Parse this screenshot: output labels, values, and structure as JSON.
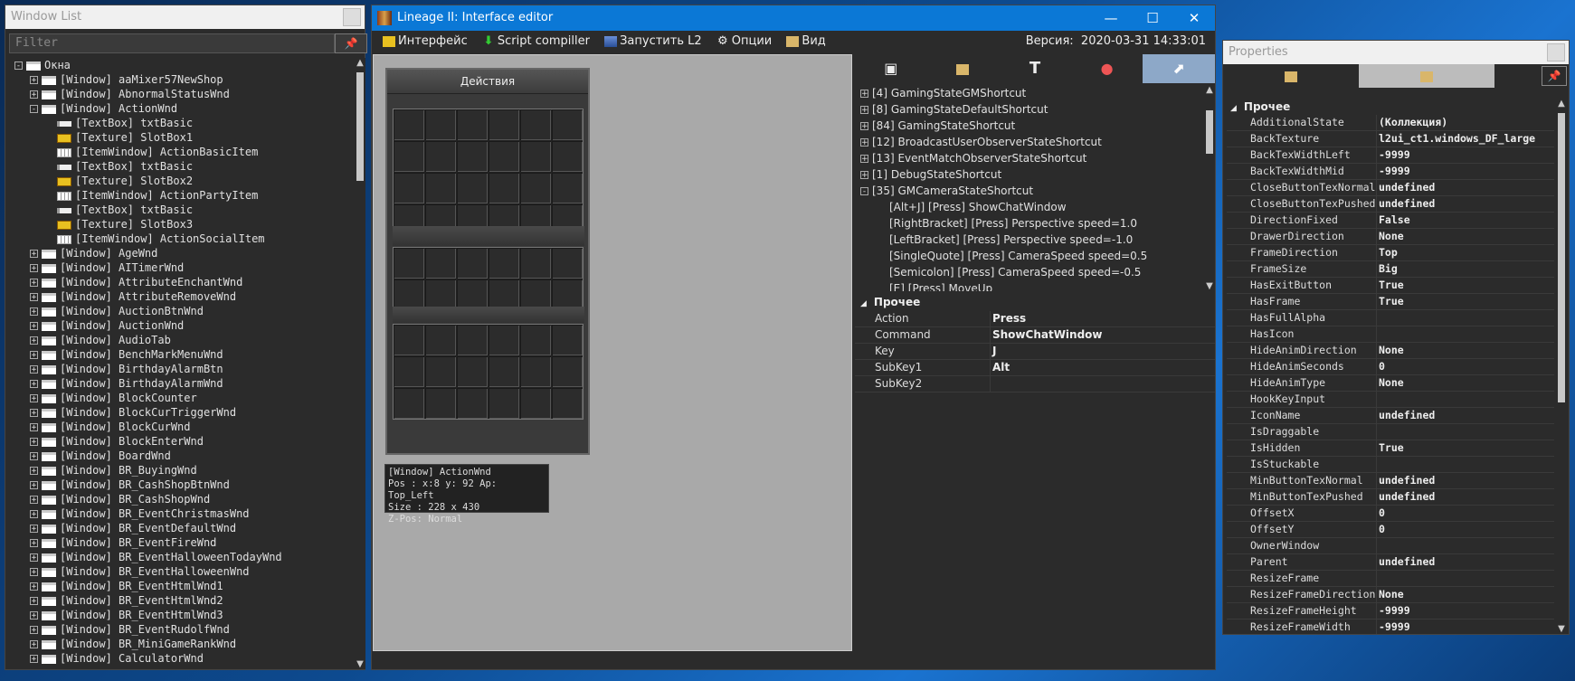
{
  "window_list": {
    "title": "Window List",
    "filter_placeholder": "Filter",
    "tree": [
      {
        "level": 0,
        "pm": "-",
        "icon": "win",
        "text": "Окна"
      },
      {
        "level": 1,
        "pm": "+",
        "icon": "win",
        "text": "[Window] aaMixer57NewShop"
      },
      {
        "level": 1,
        "pm": "+",
        "icon": "win",
        "text": "[Window] AbnormalStatusWnd"
      },
      {
        "level": 1,
        "pm": "-",
        "icon": "win",
        "text": "[Window] ActionWnd"
      },
      {
        "level": 2,
        "pm": "",
        "icon": "tb",
        "text": "[TextBox] txtBasic"
      },
      {
        "level": 2,
        "pm": "",
        "icon": "tx",
        "text": "[Texture] SlotBox1"
      },
      {
        "level": 2,
        "pm": "",
        "icon": "iw",
        "text": "[ItemWindow] ActionBasicItem"
      },
      {
        "level": 2,
        "pm": "",
        "icon": "tb",
        "text": "[TextBox] txtBasic"
      },
      {
        "level": 2,
        "pm": "",
        "icon": "tx",
        "text": "[Texture] SlotBox2"
      },
      {
        "level": 2,
        "pm": "",
        "icon": "iw",
        "text": "[ItemWindow] ActionPartyItem"
      },
      {
        "level": 2,
        "pm": "",
        "icon": "tb",
        "text": "[TextBox] txtBasic"
      },
      {
        "level": 2,
        "pm": "",
        "icon": "tx",
        "text": "[Texture] SlotBox3"
      },
      {
        "level": 2,
        "pm": "",
        "icon": "iw",
        "text": "[ItemWindow] ActionSocialItem"
      },
      {
        "level": 1,
        "pm": "+",
        "icon": "win",
        "text": "[Window] AgeWnd"
      },
      {
        "level": 1,
        "pm": "+",
        "icon": "win",
        "text": "[Window] AITimerWnd"
      },
      {
        "level": 1,
        "pm": "+",
        "icon": "win",
        "text": "[Window] AttributeEnchantWnd"
      },
      {
        "level": 1,
        "pm": "+",
        "icon": "win",
        "text": "[Window] AttributeRemoveWnd"
      },
      {
        "level": 1,
        "pm": "+",
        "icon": "win",
        "text": "[Window] AuctionBtnWnd"
      },
      {
        "level": 1,
        "pm": "+",
        "icon": "win",
        "text": "[Window] AuctionWnd"
      },
      {
        "level": 1,
        "pm": "+",
        "icon": "win",
        "text": "[Window] AudioTab"
      },
      {
        "level": 1,
        "pm": "+",
        "icon": "win",
        "text": "[Window] BenchMarkMenuWnd"
      },
      {
        "level": 1,
        "pm": "+",
        "icon": "win",
        "text": "[Window] BirthdayAlarmBtn"
      },
      {
        "level": 1,
        "pm": "+",
        "icon": "win",
        "text": "[Window] BirthdayAlarmWnd"
      },
      {
        "level": 1,
        "pm": "+",
        "icon": "win",
        "text": "[Window] BlockCounter"
      },
      {
        "level": 1,
        "pm": "+",
        "icon": "win",
        "text": "[Window] BlockCurTriggerWnd"
      },
      {
        "level": 1,
        "pm": "+",
        "icon": "win",
        "text": "[Window] BlockCurWnd"
      },
      {
        "level": 1,
        "pm": "+",
        "icon": "win",
        "text": "[Window] BlockEnterWnd"
      },
      {
        "level": 1,
        "pm": "+",
        "icon": "win",
        "text": "[Window] BoardWnd"
      },
      {
        "level": 1,
        "pm": "+",
        "icon": "win",
        "text": "[Window] BR_BuyingWnd"
      },
      {
        "level": 1,
        "pm": "+",
        "icon": "win",
        "text": "[Window] BR_CashShopBtnWnd"
      },
      {
        "level": 1,
        "pm": "+",
        "icon": "win",
        "text": "[Window] BR_CashShopWnd"
      },
      {
        "level": 1,
        "pm": "+",
        "icon": "win",
        "text": "[Window] BR_EventChristmasWnd"
      },
      {
        "level": 1,
        "pm": "+",
        "icon": "win",
        "text": "[Window] BR_EventDefaultWnd"
      },
      {
        "level": 1,
        "pm": "+",
        "icon": "win",
        "text": "[Window] BR_EventFireWnd"
      },
      {
        "level": 1,
        "pm": "+",
        "icon": "win",
        "text": "[Window] BR_EventHalloweenTodayWnd"
      },
      {
        "level": 1,
        "pm": "+",
        "icon": "win",
        "text": "[Window] BR_EventHalloweenWnd"
      },
      {
        "level": 1,
        "pm": "+",
        "icon": "win",
        "text": "[Window] BR_EventHtmlWnd1"
      },
      {
        "level": 1,
        "pm": "+",
        "icon": "win",
        "text": "[Window] BR_EventHtmlWnd2"
      },
      {
        "level": 1,
        "pm": "+",
        "icon": "win",
        "text": "[Window] BR_EventHtmlWnd3"
      },
      {
        "level": 1,
        "pm": "+",
        "icon": "win",
        "text": "[Window] BR_EventRudolfWnd"
      },
      {
        "level": 1,
        "pm": "+",
        "icon": "win",
        "text": "[Window] BR_MiniGameRankWnd"
      },
      {
        "level": 1,
        "pm": "+",
        "icon": "win",
        "text": "[Window] CalculatorWnd"
      }
    ]
  },
  "editor": {
    "title": "Lineage II: Interface editor",
    "menu": [
      "Интерфейс",
      "Script compiller",
      "Запустить L2",
      "Опции",
      "Вид"
    ],
    "version_label": "Версия:",
    "version_value": "2020-03-31 14:33:01",
    "game_window_title": "Действия",
    "info": {
      "line1": "[Window] ActionWnd",
      "line2": "Pos  : x:8 y: 92 Ap: Top_Left",
      "line3": "Size : 228 x 430",
      "line4": "Z-Pos: Normal"
    },
    "tab_icons": [
      "windows-icon",
      "texture-icon",
      "text-icon",
      "color-icon",
      "shortcut-icon"
    ],
    "shortcuts": [
      {
        "pm": "+",
        "text": "[4] GamingStateGMShortcut"
      },
      {
        "pm": "+",
        "text": "[8] GamingStateDefaultShortcut"
      },
      {
        "pm": "+",
        "text": "[84] GamingStateShortcut"
      },
      {
        "pm": "+",
        "text": "[12] BroadcastUserObserverStateShortcut"
      },
      {
        "pm": "+",
        "text": "[13] EventMatchObserverStateShortcut"
      },
      {
        "pm": "+",
        "text": "[1] DebugStateShortcut"
      },
      {
        "pm": "-",
        "text": "[35] GMCameraStateShortcut"
      }
    ],
    "shortcut_children": [
      "[Alt+J] [Press] ShowChatWindow",
      "[RightBracket] [Press] Perspective speed=1.0",
      "[LeftBracket] [Press] Perspective speed=-1.0",
      "[SingleQuote] [Press] CameraSpeed speed=0.5",
      "[Semicolon] [Press] CameraSpeed speed=-0.5",
      "[E] [Press] MoveUp"
    ],
    "section": "Прочее",
    "props": [
      {
        "k": "Action",
        "v": "Press"
      },
      {
        "k": "Command",
        "v": "ShowChatWindow"
      },
      {
        "k": "Key",
        "v": "J"
      },
      {
        "k": "SubKey1",
        "v": "Alt"
      },
      {
        "k": "SubKey2",
        "v": ""
      }
    ]
  },
  "properties": {
    "title": "Properties",
    "section": "Прочее",
    "rows": [
      {
        "k": "AdditionalState",
        "v": "(Коллекция)"
      },
      {
        "k": "BackTexture",
        "v": "l2ui_ct1.windows_DF_large"
      },
      {
        "k": "BackTexWidthLeft",
        "v": "-9999"
      },
      {
        "k": "BackTexWidthMid",
        "v": "-9999"
      },
      {
        "k": "CloseButtonTexNormal",
        "v": "undefined"
      },
      {
        "k": "CloseButtonTexPushed",
        "v": "undefined"
      },
      {
        "k": "DirectionFixed",
        "v": "False"
      },
      {
        "k": "DrawerDirection",
        "v": "None"
      },
      {
        "k": "FrameDirection",
        "v": "Top"
      },
      {
        "k": "FrameSize",
        "v": "Big"
      },
      {
        "k": "HasExitButton",
        "v": "True"
      },
      {
        "k": "HasFrame",
        "v": "True"
      },
      {
        "k": "HasFullAlpha",
        "v": ""
      },
      {
        "k": "HasIcon",
        "v": ""
      },
      {
        "k": "HideAnimDirection",
        "v": "None"
      },
      {
        "k": "HideAnimSeconds",
        "v": "0"
      },
      {
        "k": "HideAnimType",
        "v": "None"
      },
      {
        "k": "HookKeyInput",
        "v": ""
      },
      {
        "k": "IconName",
        "v": "undefined"
      },
      {
        "k": "IsDraggable",
        "v": ""
      },
      {
        "k": "IsHidden",
        "v": "True"
      },
      {
        "k": "IsStuckable",
        "v": ""
      },
      {
        "k": "MinButtonTexNormal",
        "v": "undefined"
      },
      {
        "k": "MinButtonTexPushed",
        "v": "undefined"
      },
      {
        "k": "OffsetX",
        "v": "0"
      },
      {
        "k": "OffsetY",
        "v": "0"
      },
      {
        "k": "OwnerWindow",
        "v": ""
      },
      {
        "k": "Parent",
        "v": "undefined"
      },
      {
        "k": "ResizeFrame",
        "v": ""
      },
      {
        "k": "ResizeFrameDirection",
        "v": "None"
      },
      {
        "k": "ResizeFrameHeight",
        "v": "-9999"
      },
      {
        "k": "ResizeFrameWidth",
        "v": "-9999"
      }
    ]
  }
}
